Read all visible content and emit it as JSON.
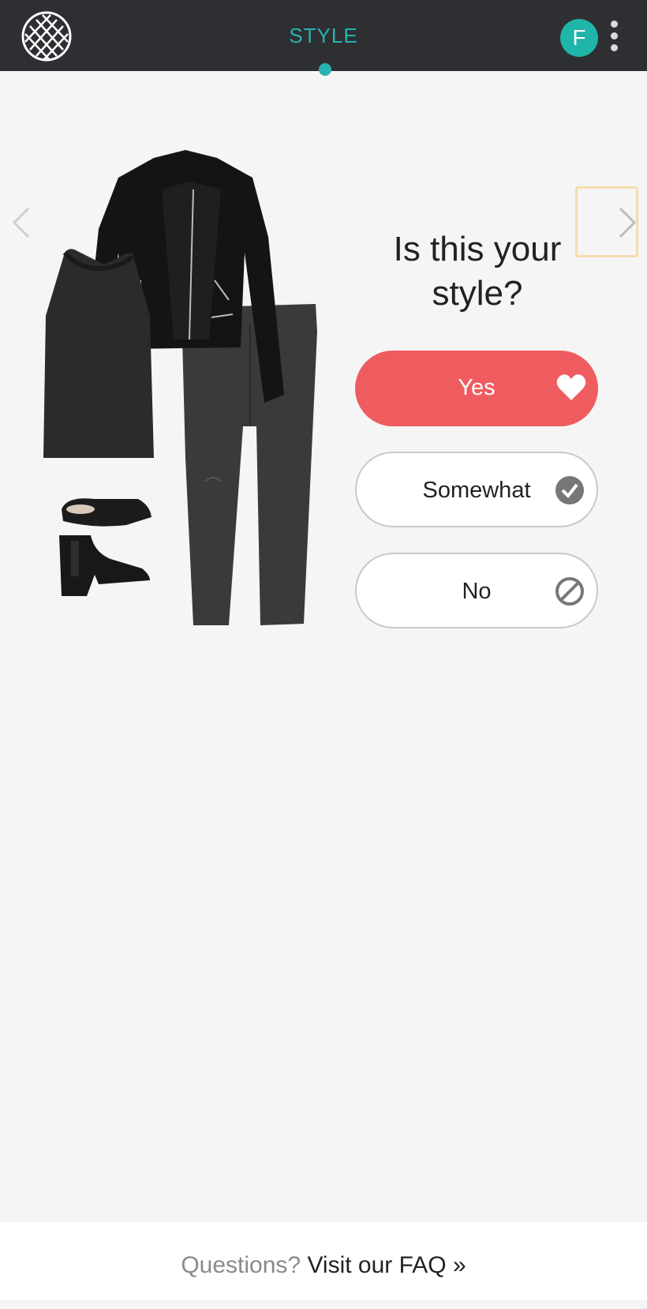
{
  "header": {
    "title": "STYLE",
    "avatar_initial": "F"
  },
  "question": {
    "text": "Is this your style?"
  },
  "choices": [
    {
      "label": "Yes",
      "icon": "heart-icon",
      "color": "#ef5c60"
    },
    {
      "label": "Somewhat",
      "icon": "check-circle-icon"
    },
    {
      "label": "No",
      "icon": "ban-icon"
    }
  ],
  "footer": {
    "question": "Questions?",
    "link": "Visit our FAQ »"
  },
  "colors": {
    "topbar": "#2e2f33",
    "accent": "#27b3b0",
    "yes": "#ef5c60",
    "background": "#f5f5f5"
  }
}
